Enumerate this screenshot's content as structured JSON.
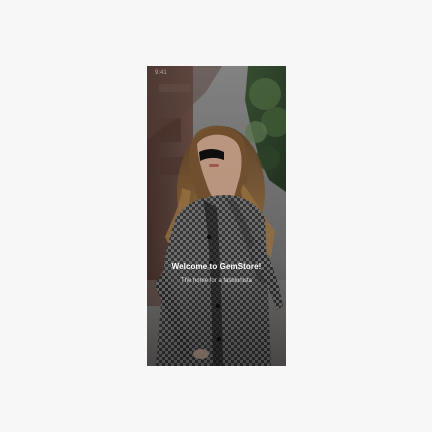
{
  "status_bar": {
    "time": "9:41"
  },
  "welcome": {
    "title": "Welcome to GemStore!",
    "subtitle": "The home for a fashionista"
  },
  "colors": {
    "page_background": "#f7f7f7",
    "text_primary": "#ffffff"
  },
  "image": {
    "semantic": "fashion-model-photo"
  }
}
